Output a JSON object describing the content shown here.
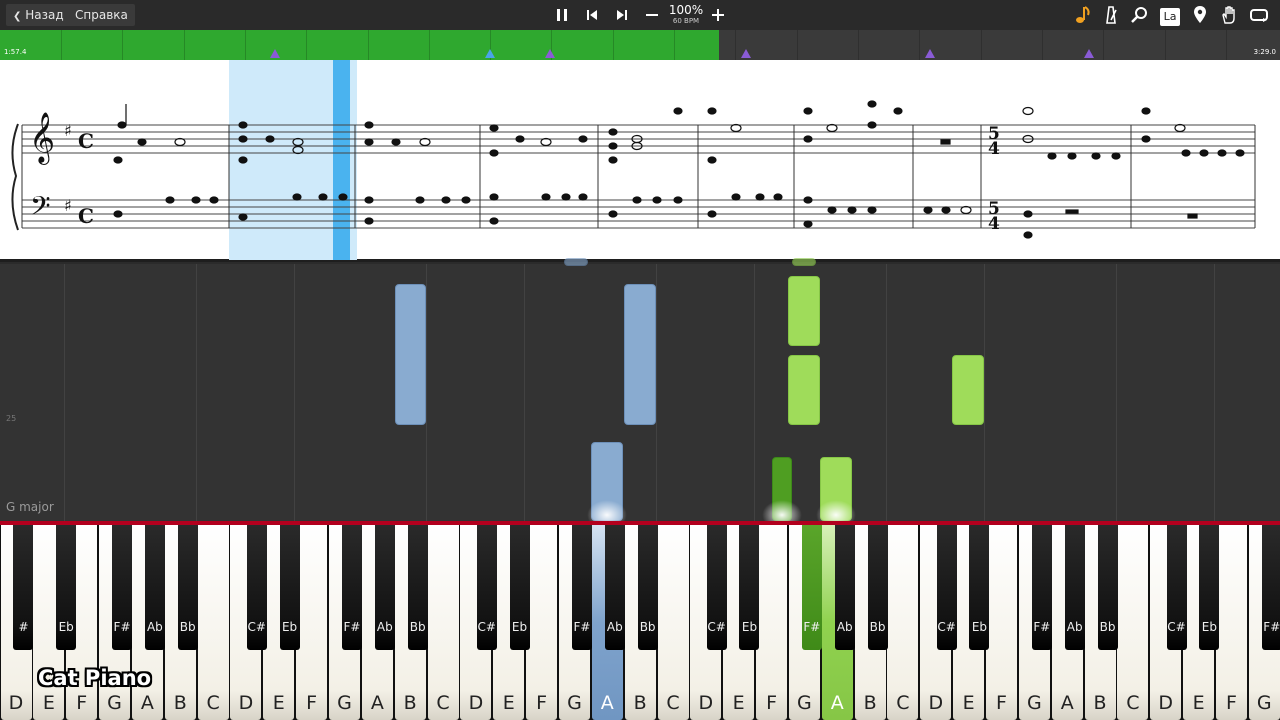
{
  "toolbar": {
    "back_label": "Назад",
    "help_label": "Справка",
    "zoom_percent": "100%",
    "bpm": "60 BPM",
    "icons": [
      "pause-icon",
      "skip-back-icon",
      "skip-forward-icon",
      "minus-icon",
      "plus-icon",
      "note-icon",
      "metronome-icon",
      "search-icon",
      "la-button",
      "location-pin-icon",
      "hand-icon",
      "loop-icon"
    ],
    "la_label": "La"
  },
  "progress": {
    "elapsed": "1:57.4",
    "total": "3:29.0",
    "fraction": 0.562,
    "fill_color": "#2fa82f"
  },
  "score": {
    "time_signature_start": "C",
    "time_signature_change_top": "5",
    "time_signature_change_bottom": "4",
    "key_signature": "G major (F#)"
  },
  "roll": {
    "key_label": "G major",
    "row_number": "25"
  },
  "keyboard": {
    "white_keys": [
      "D",
      "E",
      "F",
      "G",
      "A",
      "B",
      "C",
      "D",
      "E",
      "F",
      "G",
      "A",
      "B",
      "C",
      "D",
      "E",
      "F",
      "G",
      "A",
      "B",
      "C",
      "D",
      "E",
      "F",
      "G",
      "A",
      "B",
      "C",
      "D",
      "E",
      "F",
      "G",
      "A",
      "B",
      "C",
      "D",
      "E",
      "F",
      "G",
      "A",
      "B"
    ],
    "black_keys": [
      "#",
      "Eb",
      "F#",
      "Ab",
      "Bb",
      "C#",
      "Eb",
      "F#",
      "Ab",
      "Bb",
      "C#",
      "Eb",
      "F#",
      "Ab",
      "Bb",
      "C#",
      "Eb",
      "F#",
      "Ab",
      "Bb",
      "C#",
      "Eb",
      "F#",
      "Ab",
      "Bb",
      "C#",
      "Eb",
      "F#",
      "#"
    ],
    "brand": "Cat Piano"
  },
  "colors": {
    "left_hand": "#89abd0",
    "right_hand": "#9fdc5a",
    "accent_red": "#b3001e"
  }
}
